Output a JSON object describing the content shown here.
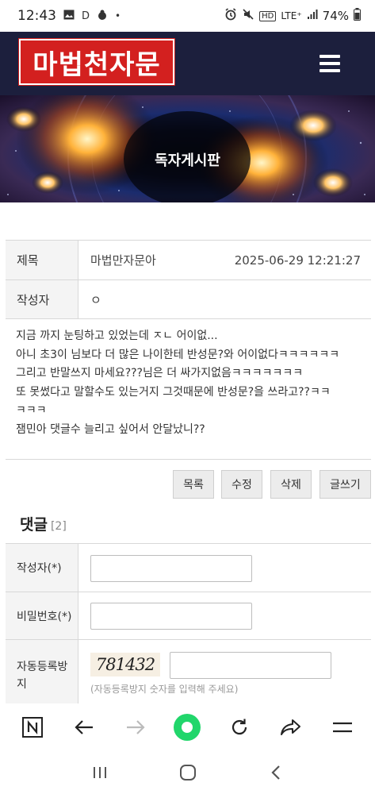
{
  "status_bar": {
    "time": "12:43",
    "battery": "74%",
    "network": "LTE⁺"
  },
  "header": {
    "logo_text": "마법천자문"
  },
  "banner": {
    "title": "독자게시판"
  },
  "post": {
    "title_label": "제목",
    "title": "마법만자문아",
    "date": "2025-06-29 12:21:27",
    "author_label": "작성자",
    "author": "ㅇ",
    "body_lines": [
      "지금 까지 눈팅하고 있었는데 ㅈㄴ 어이없...",
      "아니 초3이 님보다 더 많은 나이한테 반성문?와 어이없다ㅋㅋㅋㅋㅋㅋ",
      "그리고 반말쓰지 마세요???님은 더 싸가지없음ㅋㅋㅋㅋㅋㅋㅋ",
      "또 못썼다고 말할수도 있는거지 그것때문에 반성문?을 쓰라고??ㅋㅋ",
      "ㅋㅋㅋ",
      "잼민아 댓글수 늘리고 싶어서 안달났니??"
    ]
  },
  "actions": {
    "list": "목록",
    "edit": "수정",
    "delete": "삭제",
    "write": "글쓰기"
  },
  "comments": {
    "heading": "댓글",
    "count": "[2]",
    "author_label": "작성자(*)",
    "password_label": "비밀번호(*)",
    "captcha_label": "자동등록방지",
    "captcha_code": "781432",
    "captcha_hint": "(자동등록방지 숫자를 입력해 주세요)"
  }
}
